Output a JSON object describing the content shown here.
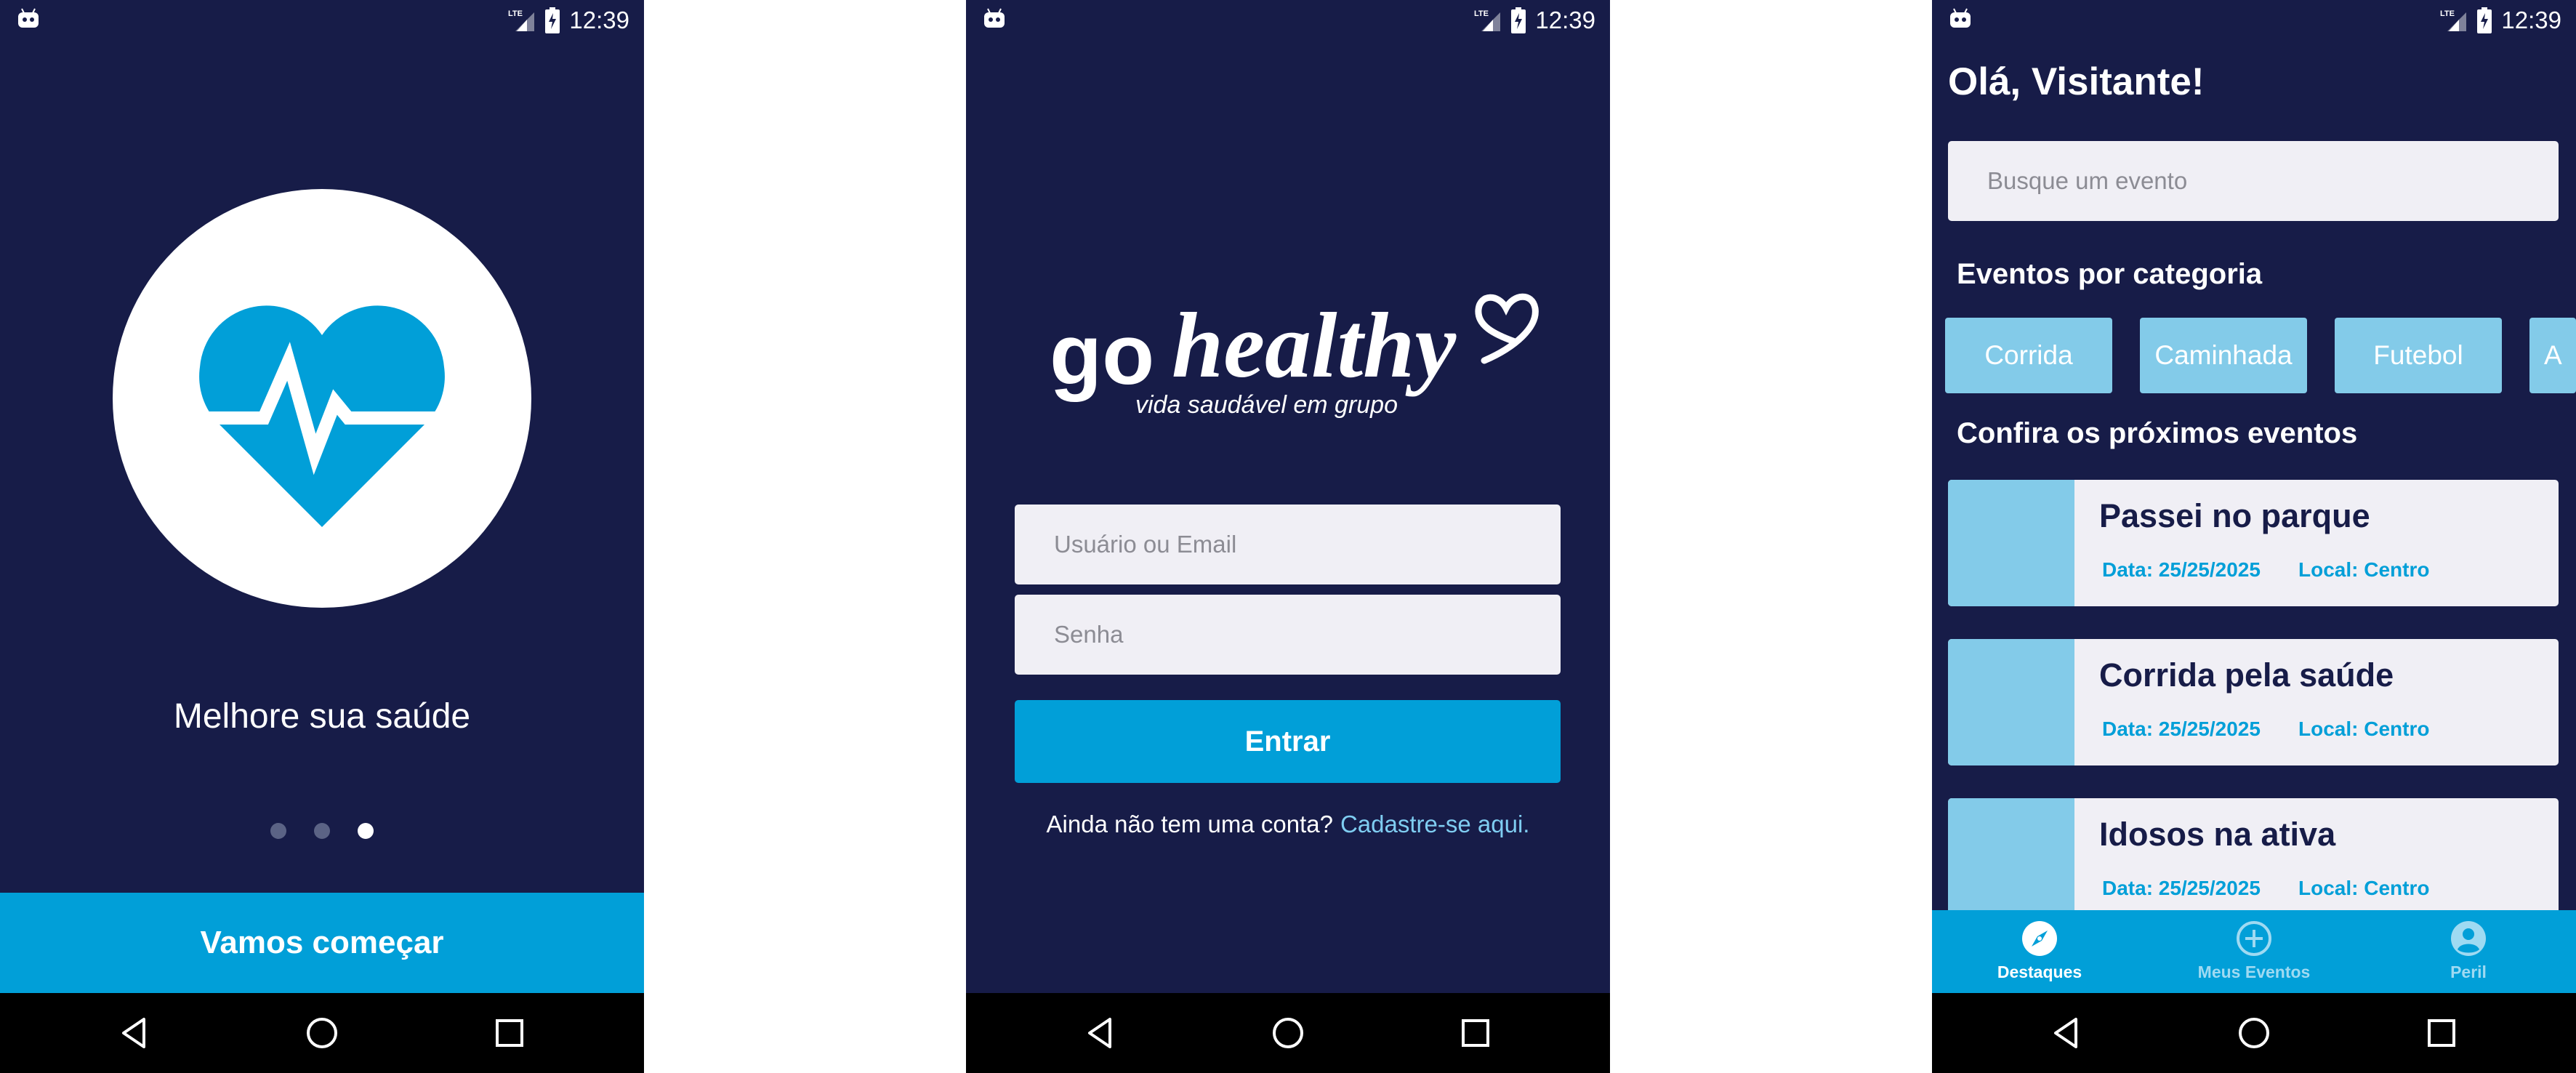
{
  "status": {
    "time": "12:39",
    "network": "LTE"
  },
  "screens": {
    "onboarding": {
      "title": "Melhore sua saúde",
      "pages_total": 3,
      "current_page": 3,
      "cta": "Vamos começar"
    },
    "login": {
      "logo": {
        "word1": "go",
        "word2": "healthy",
        "tagline": "vida saudável em grupo"
      },
      "username_placeholder": "Usuário ou Email",
      "password_placeholder": "Senha",
      "submit": "Entrar",
      "signup_prompt": "Ainda não tem uma conta?",
      "signup_link": "Cadastre-se aqui."
    },
    "home": {
      "greeting": "Olá, Visitante!",
      "search_placeholder": "Busque um evento",
      "categories_title": "Eventos por categoria",
      "categories": [
        "Corrida",
        "Caminhada",
        "Futebol",
        "A"
      ],
      "events_title": "Confira os próximos eventos",
      "events": [
        {
          "title": "Passei no parque",
          "date": "Data: 25/25/2025",
          "location": "Local: Centro"
        },
        {
          "title": "Corrida pela saúde",
          "date": "Data: 25/25/2025",
          "location": "Local: Centro"
        },
        {
          "title": "Idosos na ativa",
          "date": "Data: 25/25/2025",
          "location": "Local: Centro"
        }
      ],
      "tabs": [
        {
          "label": "Destaques",
          "icon": "compass-icon",
          "active": true
        },
        {
          "label": "Meus Eventos",
          "icon": "add-circle-icon",
          "active": false
        },
        {
          "label": "Peril",
          "icon": "profile-icon",
          "active": false
        }
      ]
    }
  },
  "colors": {
    "background": "#171c48",
    "accent": "#019fd8",
    "light_accent": "#83cbe9",
    "field": "#f0eff5",
    "link": "#7fcdf1"
  }
}
